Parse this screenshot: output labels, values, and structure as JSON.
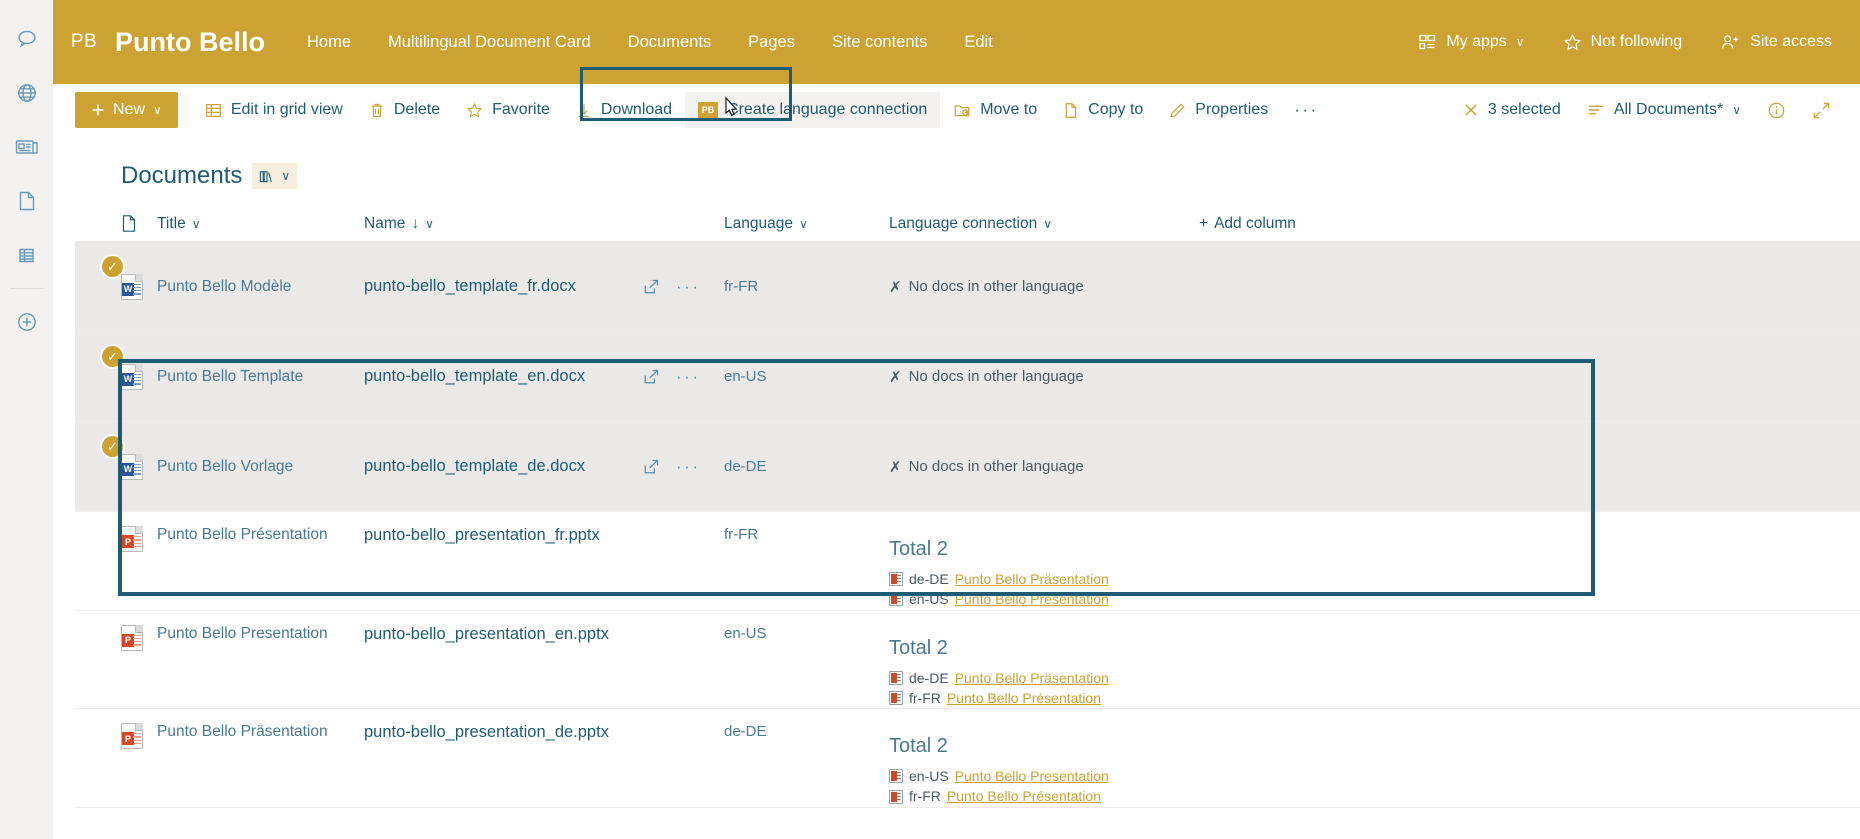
{
  "rail": {
    "items": [
      {
        "icon": "chat-icon",
        "name": "rail-item-chat"
      },
      {
        "icon": "globe-icon",
        "name": "rail-item-globe"
      },
      {
        "icon": "news-icon",
        "name": "rail-item-news"
      },
      {
        "icon": "page-icon",
        "name": "rail-item-page"
      },
      {
        "icon": "list-icon",
        "name": "rail-item-list"
      },
      {
        "icon": "plus-circle-icon",
        "name": "rail-item-create"
      }
    ]
  },
  "header": {
    "logo_initials": "PB",
    "site_title": "Punto Bello",
    "accent_color": "#cca233",
    "nav": [
      {
        "label": "Home"
      },
      {
        "label": "Multilingual Document Card"
      },
      {
        "label": "Documents"
      },
      {
        "label": "Pages"
      },
      {
        "label": "Site contents"
      },
      {
        "label": "Edit"
      }
    ],
    "actions": [
      {
        "label": "My apps",
        "icon": "apps-icon",
        "chevron": "∨"
      },
      {
        "label": "Not following",
        "icon": "star-icon",
        "chevron": ""
      },
      {
        "label": "Site access",
        "icon": "people-add-icon",
        "chevron": ""
      }
    ]
  },
  "commandbar": {
    "new_label": "New",
    "new_chevron": "∨",
    "items": [
      {
        "label": "Edit in grid view",
        "icon": "grid-icon"
      },
      {
        "label": "Delete",
        "icon": "trash-icon"
      },
      {
        "label": "Favorite",
        "icon": "star-icon"
      },
      {
        "label": "Download",
        "icon": "download-icon"
      },
      {
        "label": "Create language connection",
        "icon": "pb-tile-icon",
        "highlighted": true
      },
      {
        "label": "Move to",
        "icon": "move-to-icon"
      },
      {
        "label": "Copy to",
        "icon": "copy-to-icon"
      },
      {
        "label": "Properties",
        "icon": "pencil-icon"
      }
    ],
    "overflow_label": "···",
    "selected_label": "3 selected",
    "view_label": "All Documents*",
    "view_chevron": "∨",
    "info_icon": "info-icon",
    "expand_icon": "expand-icon"
  },
  "library": {
    "title": "Documents",
    "pill_icon": "books-icon",
    "pill_chevron": "∨",
    "columns": [
      {
        "key": "icon",
        "label": "",
        "icon": "file-type-icon"
      },
      {
        "key": "title",
        "label": "Title",
        "chevron": "∨"
      },
      {
        "key": "name",
        "label": "Name",
        "sort": "↓",
        "chevron": "∨"
      },
      {
        "key": "language",
        "label": "Language",
        "chevron": "∨"
      },
      {
        "key": "connection",
        "label": "Language connection",
        "chevron": "∨"
      },
      {
        "key": "add",
        "label": "Add column",
        "plus": "+"
      }
    ],
    "no_connection_text": "No docs in other language",
    "no_connection_mark": "✗",
    "total_prefix": "Total",
    "rows": [
      {
        "selected": true,
        "file_type": "word",
        "title": "Punto Bello Modèle",
        "name": "punto-bello_template_fr.docx",
        "language": "fr-FR",
        "has_actions": true,
        "connection_total": null,
        "connection_empty": "No docs in other language",
        "connections": []
      },
      {
        "selected": true,
        "file_type": "word",
        "title": "Punto Bello Template",
        "name": "punto-bello_template_en.docx",
        "language": "en-US",
        "has_actions": true,
        "connection_total": null,
        "connection_empty": "No docs in other language",
        "connections": []
      },
      {
        "selected": true,
        "file_type": "word",
        "title": "Punto Bello Vorlage",
        "name": "punto-bello_template_de.docx",
        "language": "de-DE",
        "has_actions": true,
        "connection_total": null,
        "connection_empty": "No docs in other language",
        "connections": []
      },
      {
        "selected": false,
        "file_type": "ppt",
        "title": "Punto Bello Présentation",
        "name": "punto-bello_presentation_fr.pptx",
        "language": "fr-FR",
        "has_actions": false,
        "connection_total": "Total 2",
        "connection_empty": null,
        "connections": [
          {
            "lang": "de-DE",
            "label": "Punto Bello Präsentation"
          },
          {
            "lang": "en-US",
            "label": "Punto Bello Presentation"
          }
        ]
      },
      {
        "selected": false,
        "file_type": "ppt",
        "title": "Punto Bello Presentation",
        "name": "punto-bello_presentation_en.pptx",
        "language": "en-US",
        "has_actions": false,
        "connection_total": "Total 2",
        "connection_empty": null,
        "connections": [
          {
            "lang": "de-DE",
            "label": "Punto Bello Präsentation"
          },
          {
            "lang": "fr-FR",
            "label": "Punto Bello Présentation"
          }
        ]
      },
      {
        "selected": false,
        "file_type": "ppt",
        "title": "Punto Bello Präsentation",
        "name": "punto-bello_presentation_de.pptx",
        "language": "de-DE",
        "has_actions": false,
        "connection_total": "Total 2",
        "connection_empty": null,
        "connections": [
          {
            "lang": "en-US",
            "label": "Punto Bello Presentation"
          },
          {
            "lang": "fr-FR",
            "label": "Punto Bello Présentation"
          }
        ]
      }
    ]
  }
}
